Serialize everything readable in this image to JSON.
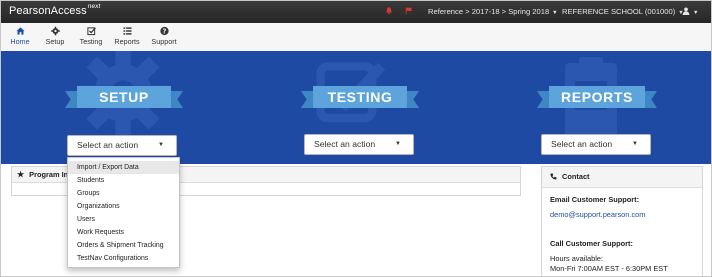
{
  "topbar": {
    "brand": "PearsonAccess",
    "brand_sup": "next",
    "context": "Reference > 2017-18 > Spring 2018",
    "organization": "REFERENCE SCHOOL (001000)",
    "icons": [
      "bell-icon",
      "flag-icon",
      "user-icon"
    ]
  },
  "nav": {
    "items": [
      {
        "label": "Home",
        "icon": "home-icon",
        "active": true
      },
      {
        "label": "Setup",
        "icon": "gear-icon",
        "active": false
      },
      {
        "label": "Testing",
        "icon": "checkbox-icon",
        "active": false
      },
      {
        "label": "Reports",
        "icon": "list-icon",
        "active": false
      },
      {
        "label": "Support",
        "icon": "question-icon",
        "active": false
      }
    ]
  },
  "banner": {
    "background": "#1f4aa3",
    "ribbon_color": "#5da4dc",
    "sections": [
      {
        "title": "SETUP",
        "select_placeholder": "Select an action"
      },
      {
        "title": "TESTING",
        "select_placeholder": "Select an action"
      },
      {
        "title": "REPORTS",
        "select_placeholder": "Select an action"
      }
    ]
  },
  "setup_menu": {
    "items": [
      "Import / Export Data",
      "Students",
      "Groups",
      "Organizations",
      "Users",
      "Work Requests",
      "Orders & Shipment Tracking",
      "TestNav Configurations"
    ]
  },
  "program_panel": {
    "title": "Program Inf"
  },
  "contact_panel": {
    "title": "Contact",
    "email_heading": "Email Customer Support:",
    "email": "demo@support.pearson.com",
    "call_heading": "Call Customer Support:",
    "hours_label": "Hours available:",
    "hours": "Mon-Fri 7:00AM EST - 6:30PM EST"
  }
}
